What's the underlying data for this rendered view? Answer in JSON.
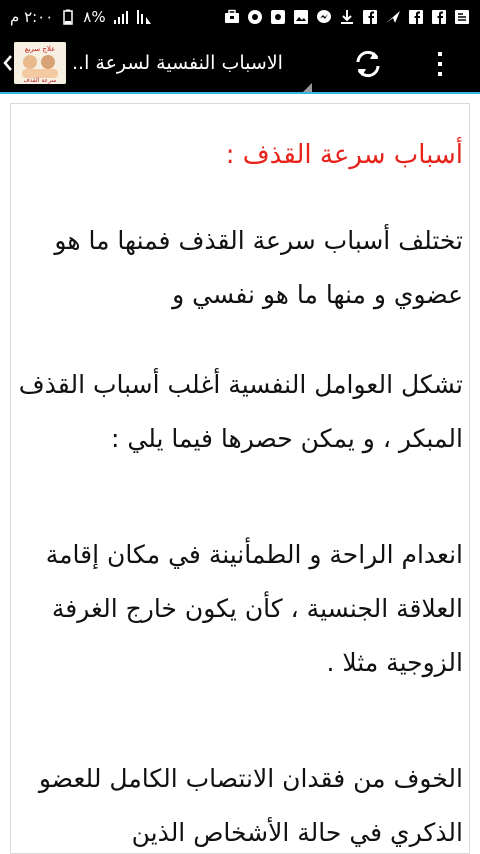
{
  "status_bar": {
    "time": "٢:٠٠ م",
    "battery_percent": "%٨",
    "left_icons": [
      "ampm-icon",
      "battery-icon",
      "signal-icon",
      "wifi-icon"
    ],
    "right_icons": [
      "notification-icon",
      "notification-icon",
      "facebook-icon",
      "facebook-icon",
      "send-icon",
      "facebook-icon",
      "download-icon",
      "messenger-icon",
      "gallery-icon",
      "settings-icon",
      "vpn-icon",
      "briefcase-icon"
    ]
  },
  "action_bar": {
    "title": "الاسباب النفسية لسرعة ا..",
    "logo_text_line1": "علاج سريع",
    "logo_text_line2": "سرعة القذف"
  },
  "article": {
    "heading": "أسباب سرعة القذف :",
    "paragraphs": [
      "تختلف أسباب سرعة القذف فمنها ما هو عضوي و منها ما هو نفسي و",
      "تشكل العوامل النفسية أغلب أسباب القذف المبكر ، و يمكن حصرها فيما يلي :",
      "انعدام الراحة و الطمأنينة في مكان إقامة العلاقة الجنسية ، كأن يكون خارج الغرفة الزوجية مثلا .",
      "الخوف من فقدان الانتصاب الكامل للعضو الذكري في حالة الأشخاص الذين"
    ]
  },
  "colors": {
    "heading": "#e8231b",
    "accent_divider": "#33b5e5",
    "bar_background": "#000000"
  }
}
